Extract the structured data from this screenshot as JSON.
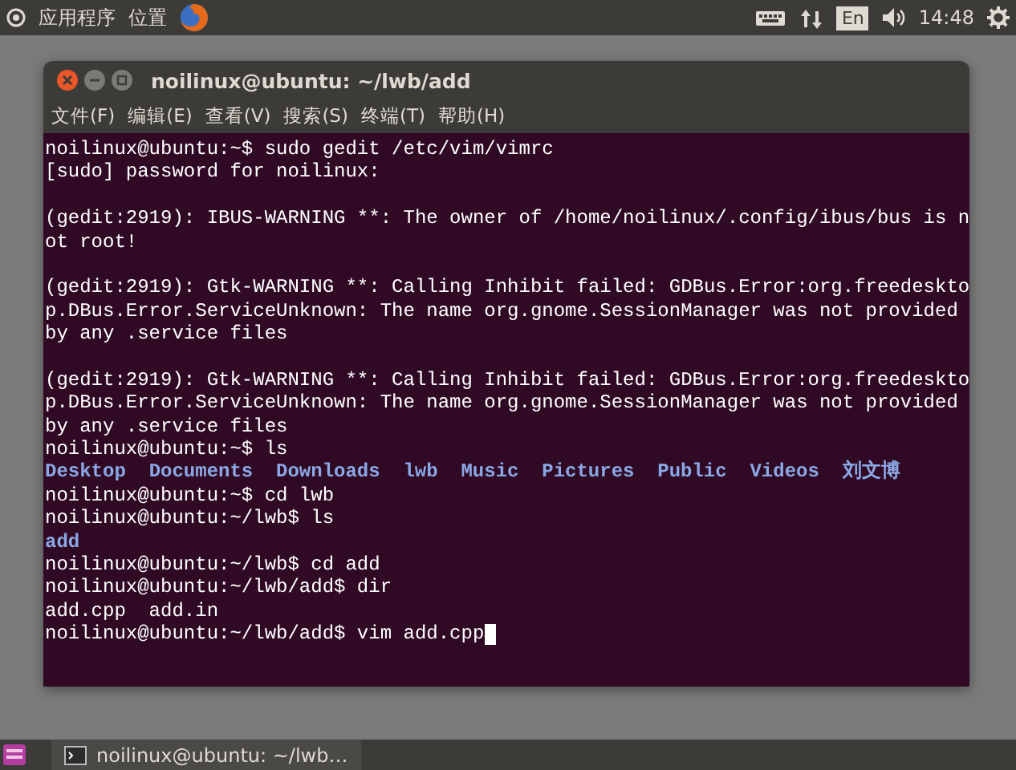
{
  "top_panel": {
    "menus": [
      "应用程序",
      "位置"
    ],
    "input_method": "En",
    "clock": "14:48"
  },
  "window": {
    "title": "noilinux@ubuntu: ~/lwb/add",
    "menu": [
      "文件(F)",
      "编辑(E)",
      "查看(V)",
      "搜索(S)",
      "终端(T)",
      "帮助(H)"
    ]
  },
  "terminal": {
    "lines": [
      {
        "kind": "text",
        "text": "noilinux@ubuntu:~$ sudo gedit /etc/vim/vimrc"
      },
      {
        "kind": "text",
        "text": "[sudo] password for noilinux:"
      },
      {
        "kind": "blank"
      },
      {
        "kind": "text",
        "text": "(gedit:2919): IBUS-WARNING **: The owner of /home/noilinux/.config/ibus/bus is n"
      },
      {
        "kind": "text",
        "text": "ot root!"
      },
      {
        "kind": "blank"
      },
      {
        "kind": "text",
        "text": "(gedit:2919): Gtk-WARNING **: Calling Inhibit failed: GDBus.Error:org.freedeskto"
      },
      {
        "kind": "text",
        "text": "p.DBus.Error.ServiceUnknown: The name org.gnome.SessionManager was not provided"
      },
      {
        "kind": "text",
        "text": "by any .service files"
      },
      {
        "kind": "blank"
      },
      {
        "kind": "text",
        "text": "(gedit:2919): Gtk-WARNING **: Calling Inhibit failed: GDBus.Error:org.freedeskto"
      },
      {
        "kind": "text",
        "text": "p.DBus.Error.ServiceUnknown: The name org.gnome.SessionManager was not provided"
      },
      {
        "kind": "text",
        "text": "by any .service files"
      },
      {
        "kind": "text",
        "text": "noilinux@ubuntu:~$ ls"
      },
      {
        "kind": "listing",
        "items": [
          "Desktop",
          "Documents",
          "Downloads",
          "lwb",
          "Music",
          "Pictures",
          "Public",
          "Videos",
          "刘文博"
        ]
      },
      {
        "kind": "text",
        "text": "noilinux@ubuntu:~$ cd lwb"
      },
      {
        "kind": "text",
        "text": "noilinux@ubuntu:~/lwb$ ls"
      },
      {
        "kind": "listing",
        "items": [
          "add"
        ]
      },
      {
        "kind": "text",
        "text": "noilinux@ubuntu:~/lwb$ cd add"
      },
      {
        "kind": "text",
        "text": "noilinux@ubuntu:~/lwb/add$ dir"
      },
      {
        "kind": "text",
        "text": "add.cpp  add.in"
      },
      {
        "kind": "text",
        "text": "noilinux@ubuntu:~/lwb/add$ vim add.cpp",
        "cursor": true
      }
    ]
  },
  "taskbar": {
    "items": [
      {
        "label": "noilinux@ubuntu: ~/lwb…"
      }
    ]
  }
}
